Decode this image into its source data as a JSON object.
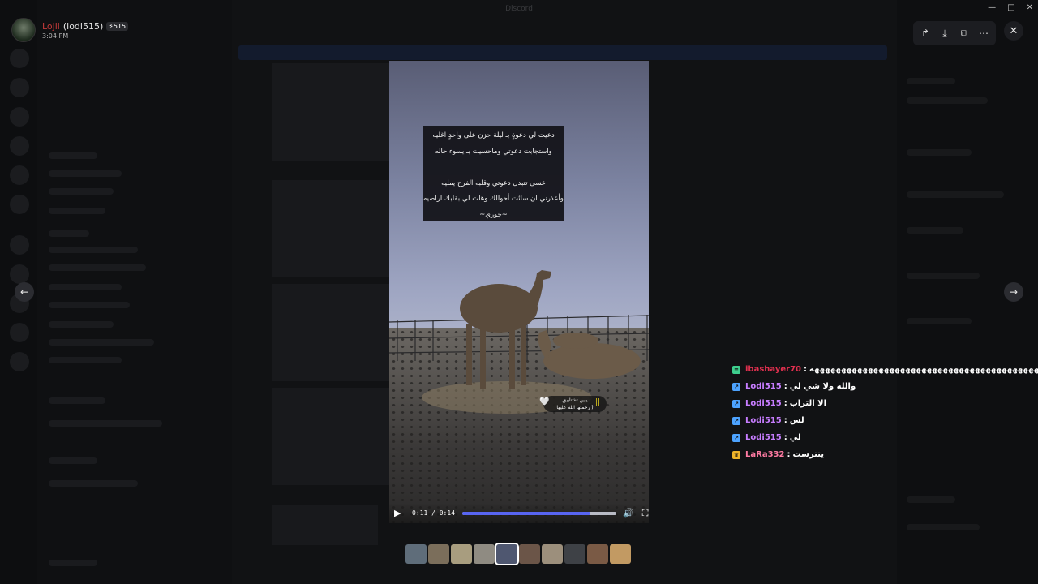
{
  "app": {
    "title": "Discord"
  },
  "author": {
    "name": "Lojii",
    "handle": "(lodi515)",
    "badge": "⚡515",
    "time": "3:04 PM"
  },
  "toolbar": {
    "forward": "↱",
    "download": "⤓",
    "open": "⧉",
    "more": "⋯",
    "close": "✕"
  },
  "window": {
    "minimize": "—",
    "maximize": "□",
    "close": "✕"
  },
  "nav": {
    "prev": "←",
    "next": "→"
  },
  "video": {
    "caption": [
      "دعيت لي دعوةٍ بـ ليلة حزن على واحدٍ اغليه",
      "واستجابت دعوتي وماحسيت بـ يسوء حاله",
      "",
      "عسى تتبدل دعوتي وقلبه الفرح يمليه",
      "وأعذرني ان سائت أحوالك وهات لي بقلبك اراضيه",
      "~جوري~"
    ],
    "sticker": {
      "line1": "يبين تشتاييق",
      "line2": "رحمتها الله عليها )",
      "heart": "🤍",
      "wave": "|||"
    },
    "time_current": "0:11",
    "time_total": "0:14",
    "progress_fraction": 0.83,
    "play_icon": "▶",
    "volume_icon": "🔊",
    "fullscreen_icon": "⛶"
  },
  "thumbnails": [
    {
      "color": "#5f6d7a"
    },
    {
      "color": "#7b6e5b"
    },
    {
      "color": "#a89d7f"
    },
    {
      "color": "#8f8b82"
    },
    {
      "color": "#4f5770",
      "active": true
    },
    {
      "color": "#6b5548"
    },
    {
      "color": "#9c8f7c"
    },
    {
      "color": "#3e4146"
    },
    {
      "color": "#7a5a45"
    },
    {
      "color": "#c29a63"
    }
  ],
  "chat": [
    {
      "user": "ibashayer70",
      "user_color": "#e0304f",
      "icon_color": "#3ecf8e",
      "icon": "≡",
      "text": "هههههههههههههههههههههههههههههههههههههههههههه"
    },
    {
      "user": "Lodi515",
      "user_color": "#c77dff",
      "icon_color": "#4da3ff",
      "icon": "↗",
      "text": "والله ولا شي لي"
    },
    {
      "user": "Lodi515",
      "user_color": "#c77dff",
      "icon_color": "#4da3ff",
      "icon": "↗",
      "text": "الا التراب"
    },
    {
      "user": "Lodi515",
      "user_color": "#c77dff",
      "icon_color": "#4da3ff",
      "icon": "↗",
      "text": "لس"
    },
    {
      "user": "Lodi515",
      "user_color": "#c77dff",
      "icon_color": "#4da3ff",
      "icon": "↗",
      "text": "لي"
    },
    {
      "user": "LaRa332",
      "user_color": "#ff7ba3",
      "icon_color": "#f0b429",
      "icon": "♛",
      "text": "يتترست"
    }
  ]
}
